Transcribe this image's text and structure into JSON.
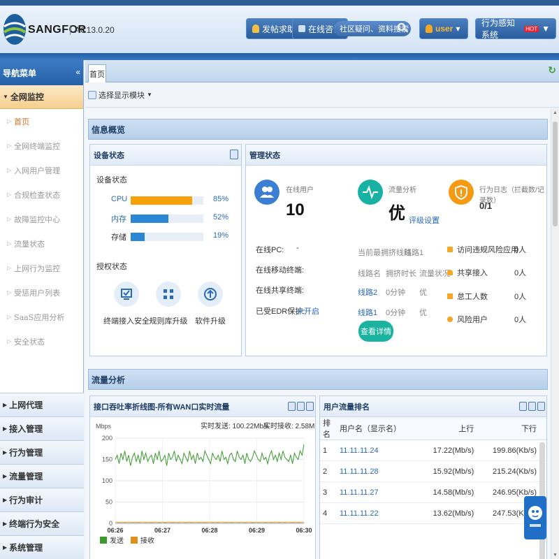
{
  "header": {
    "logo_text": "SANGFOR",
    "version": "AC13.0.20",
    "help_label": "发帖求助",
    "consult_label": "在线咨询",
    "search_placeholder": "社区疑问、资料搜索",
    "user_label": "user",
    "system_label": "行为感知系统",
    "hot_badge": "HOT"
  },
  "sidebar": {
    "title": "导航菜单",
    "group": "全网监控",
    "items": [
      "首页",
      "全网终端监控",
      "入网用户管理",
      "合规检查状态",
      "故障监控中心",
      "流量状态",
      "上网行为监控",
      "受惩用户列表",
      "SaaS应用分析",
      "安全状态"
    ],
    "sections": [
      "上网代理",
      "接入管理",
      "行为管理",
      "流量管理",
      "行为审计",
      "终端行为安全",
      "系统管理"
    ]
  },
  "tabs": {
    "home": "首页"
  },
  "toolbar": {
    "select_module": "选择显示模块"
  },
  "overview": {
    "title": "信息概览",
    "device": {
      "title": "设备状态",
      "subtitle": "设备状态",
      "cpu_label": "CPU",
      "cpu": 85,
      "cpu_text": "85%",
      "mem_label": "内存",
      "mem": 52,
      "mem_text": "52%",
      "disk_label": "存储",
      "disk": 19,
      "disk_text": "19%",
      "auth_title": "授权状态",
      "auth_items": [
        "终端接入安全",
        "规则库升级",
        "软件升级"
      ]
    },
    "manage": {
      "title": "管理状态",
      "online_label": "在线用户",
      "online_value": "10",
      "traffic_label": "流量分析",
      "traffic_value": "优",
      "traffic_link": "评级设置",
      "log_label": "行为日志（拦截数/记录数）",
      "log_value": "0/1",
      "pc_label": "在线PC:",
      "pc_value": "-",
      "mobile_label": "在线移动终端:",
      "mobile_value": "-",
      "shared_label": "在线共享终端:",
      "shared_value": "-",
      "edr_label": "已受EDR保护:",
      "edr_value": "未开启",
      "line_label": "当前最拥挤线路:",
      "line_value": "线路1",
      "col_line": "线路名",
      "col_dur": "拥挤时长",
      "col_status": "流量状况",
      "lines": [
        {
          "name": "线路2",
          "dur": "0分钟",
          "status": "优"
        },
        {
          "name": "线路1",
          "dur": "0分钟",
          "status": "优"
        }
      ],
      "detail_button": "查看详情",
      "risks": [
        {
          "label": "访问违规风险应用",
          "value": "0人"
        },
        {
          "label": "共享接入",
          "value": "0人"
        },
        {
          "label": "怠工人数",
          "value": "0人"
        },
        {
          "label": "风险用户",
          "value": "0人"
        }
      ]
    }
  },
  "traffic": {
    "title": "流量分析",
    "chart_title": "接口吞吐率折线图-所有WAN口实时流量",
    "send_label": "实时发送: 100.22Mb/s",
    "recv_label": "实时接收: 2.58Mb/s",
    "rank_title": "用户流量排名",
    "rank_cols": [
      "排名",
      "用户名（显示名）",
      "上行",
      "下行"
    ],
    "rank_rows": [
      {
        "rank": "1",
        "user": "11.11.11.24",
        "up": "17.22(Mb/s)",
        "down": "199.86(Kb/s)"
      },
      {
        "rank": "2",
        "user": "11.11.11.28",
        "up": "15.92(Mb/s)",
        "down": "215.24(Kb/s)"
      },
      {
        "rank": "3",
        "user": "11.11.11.27",
        "up": "14.58(Mb/s)",
        "down": "246.95(Kb/s)"
      },
      {
        "rank": "4",
        "user": "11.11.11.22",
        "up": "13.62(Mb/s)",
        "down": "247.53(Kb/s)"
      }
    ]
  },
  "chart_data": {
    "type": "line",
    "ylabel": "Mbps",
    "ylim": [
      0,
      200
    ],
    "yticks": [
      0,
      50,
      100,
      150,
      200
    ],
    "xticks": [
      "06:26",
      "06:27",
      "06:28",
      "06:29",
      "06:30"
    ],
    "series": [
      {
        "name": "发送",
        "color": "#3a9a2a",
        "values": [
          150,
          160,
          140,
          165,
          150,
          170,
          145,
          160,
          135,
          155,
          165,
          145,
          160,
          140,
          170,
          150,
          165,
          145,
          155,
          160,
          140,
          165,
          150,
          170,
          145,
          150,
          160,
          135,
          165,
          150,
          155,
          170,
          145,
          160,
          150,
          140,
          165,
          155,
          145,
          170,
          150,
          160,
          140,
          165,
          150,
          155,
          145,
          170,
          160,
          150,
          140,
          165,
          155,
          150,
          160,
          145,
          170,
          150,
          155,
          140,
          160,
          165,
          150,
          145,
          170,
          155,
          150,
          160,
          140,
          165,
          150,
          145,
          155,
          170,
          160,
          150,
          145,
          165,
          150,
          155,
          140,
          160,
          170,
          150,
          160,
          145,
          165,
          150,
          170,
          155,
          150,
          145,
          160,
          140,
          165,
          155,
          150,
          170,
          160,
          185
        ]
      },
      {
        "name": "接收",
        "color": "#e0901a",
        "values": [
          3,
          3,
          2,
          3,
          3,
          2,
          3,
          3,
          3,
          2,
          3,
          3,
          2,
          3,
          3,
          3,
          2,
          3,
          3,
          2,
          3,
          3,
          3,
          2,
          3,
          3,
          2,
          3,
          3,
          3,
          2,
          3,
          3,
          2,
          3,
          3,
          3,
          2,
          3,
          3,
          2,
          3,
          3,
          3,
          2,
          3,
          3,
          2,
          3,
          3,
          3,
          2,
          3,
          3,
          2,
          3,
          3,
          3,
          2,
          3,
          3,
          2,
          3,
          3,
          3,
          2,
          3,
          3,
          2,
          3,
          3,
          3,
          2,
          3,
          3,
          2,
          3,
          3,
          3,
          2,
          3,
          3,
          2,
          3,
          3,
          3,
          2,
          3,
          3,
          2,
          3,
          3,
          3,
          2,
          3,
          3,
          2,
          3,
          3,
          3
        ]
      }
    ]
  }
}
